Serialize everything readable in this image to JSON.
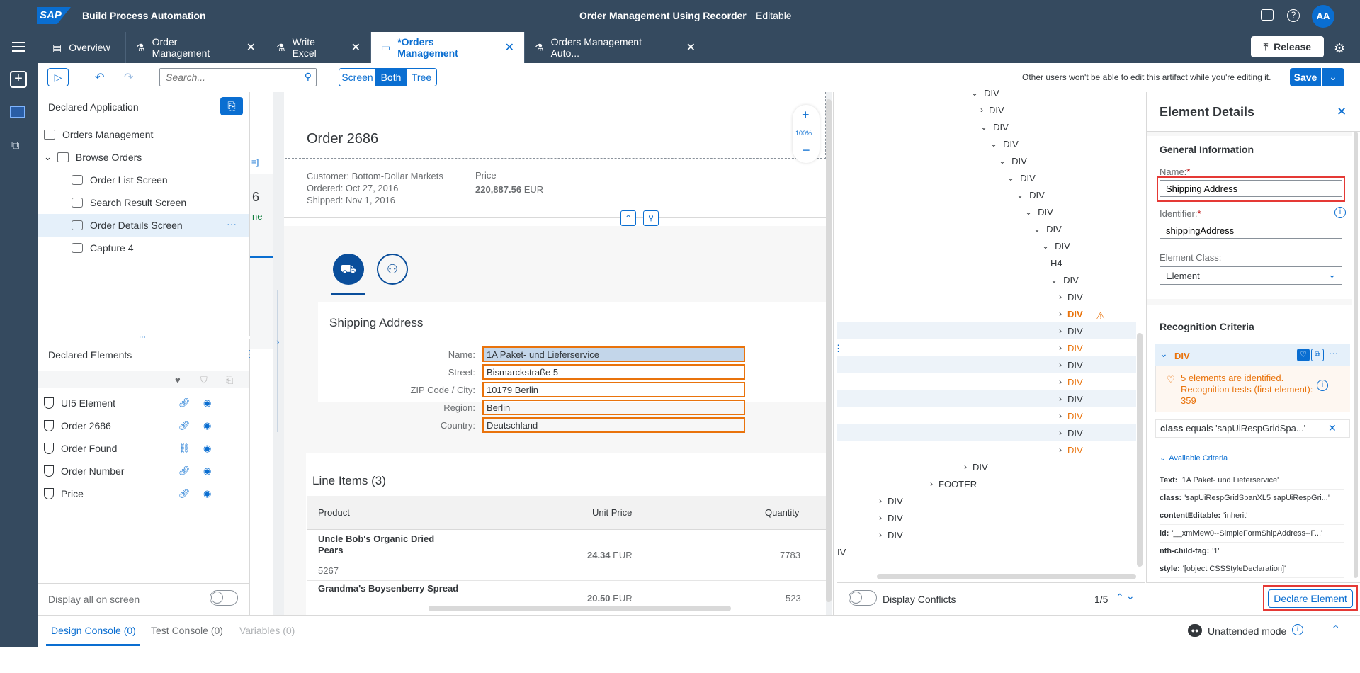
{
  "shell": {
    "logo": "SAP",
    "product": "Build Process Automation",
    "center_title": "Order Management Using Recorder",
    "status": "Editable",
    "avatar": "AA"
  },
  "tabs": [
    {
      "label": "Overview"
    },
    {
      "label": "Order Management"
    },
    {
      "label": "Write Excel"
    },
    {
      "label": "*Orders Management"
    },
    {
      "label": "Orders Management Auto..."
    }
  ],
  "release_label": "Release",
  "toolbar": {
    "search_placeholder": "Search...",
    "seg_screen": "Screen",
    "seg_both": "Both",
    "seg_tree": "Tree",
    "lock_notice": "Other users won't be able to edit this artifact while you're editing it.",
    "save_label": "Save"
  },
  "declared_app": {
    "title": "Declared Application",
    "items": [
      {
        "label": "Orders Management"
      },
      {
        "label": "Browse Orders"
      },
      {
        "label": "Order List Screen"
      },
      {
        "label": "Search Result Screen"
      },
      {
        "label": "Order Details Screen"
      },
      {
        "label": "Capture 4"
      }
    ]
  },
  "declared_elements": {
    "title": "Declared Elements",
    "items": [
      {
        "label": "UI5 Element"
      },
      {
        "label": "Order 2686"
      },
      {
        "label": "Order Found"
      },
      {
        "label": "Order Number"
      },
      {
        "label": "Price"
      }
    ],
    "display_all": "Display all on screen"
  },
  "screen": {
    "order_title": "Order 2686",
    "customer": "Customer: Bottom-Dollar Markets",
    "ordered": "Ordered: Oct 27, 2016",
    "shipped": "Shipped: Nov 1, 2016",
    "price_label": "Price",
    "price_value": "220,887.56",
    "price_currency": "EUR",
    "zoom": "100%",
    "left_partial_num": "6",
    "left_partial_text": "ne",
    "shipping_title": "Shipping Address",
    "fields": [
      {
        "label": "Name:",
        "value": "1A Paket- und Lieferservice"
      },
      {
        "label": "Street:",
        "value": "Bismarckstraße 5"
      },
      {
        "label": "ZIP Code / City:",
        "value": "10179 Berlin"
      },
      {
        "label": "Region:",
        "value": "Berlin"
      },
      {
        "label": "Country:",
        "value": "Deutschland"
      }
    ],
    "line_items_title": "Line Items (3)",
    "col_product": "Product",
    "col_unit_price": "Unit Price",
    "col_quantity": "Quantity",
    "rows": [
      {
        "product": "Uncle Bob's Organic Dried Pears",
        "id": "5267",
        "price": "24.34",
        "currency": "EUR",
        "qty": "7783"
      },
      {
        "product": "Grandma's Boysenberry Spread",
        "id": "",
        "price": "20.50",
        "currency": "EUR",
        "qty": "523"
      }
    ]
  },
  "tree": {
    "rows": [
      {
        "label": "DIV"
      },
      {
        "label": "DIV"
      },
      {
        "label": "DIV"
      },
      {
        "label": "DIV"
      },
      {
        "label": "DIV"
      },
      {
        "label": "DIV"
      },
      {
        "label": "DIV"
      },
      {
        "label": "DIV"
      },
      {
        "label": "DIV"
      },
      {
        "label": "DIV"
      },
      {
        "label": "H4"
      },
      {
        "label": "DIV"
      },
      {
        "label": "DIV"
      },
      {
        "label": "DIV"
      },
      {
        "label": "DIV"
      },
      {
        "label": "DIV"
      },
      {
        "label": "DIV"
      },
      {
        "label": "DIV"
      },
      {
        "label": "DIV"
      },
      {
        "label": "DIV"
      },
      {
        "label": "DIV"
      },
      {
        "label": "DIV"
      },
      {
        "label": "DIV"
      },
      {
        "label": "FOOTER"
      },
      {
        "label": "DIV"
      },
      {
        "label": "DIV"
      },
      {
        "label": "DIV"
      },
      {
        "label": "IV"
      }
    ],
    "display_conflicts": "Display Conflicts",
    "pager": "1/5"
  },
  "details": {
    "title": "Element Details",
    "general_info": "General Information",
    "name_label": "Name:",
    "name_value": "Shipping Address",
    "identifier_label": "Identifier:",
    "identifier_value": "shippingAddress",
    "class_label": "Element Class:",
    "class_value": "Element",
    "recognition": "Recognition Criteria",
    "crit_tag": "DIV",
    "warning": "5 elements are identified. Recognition tests (first element): 359",
    "criterion_key": "class",
    "criterion_text": "equals 'sapUiRespGridSpa...'",
    "available": "Available Criteria",
    "criteria": [
      {
        "key": "Text:",
        "val": "'1A Paket- und Lieferservice'"
      },
      {
        "key": "class:",
        "val": "'sapUiRespGridSpanXL5 sapUiRespGri...'"
      },
      {
        "key": "contentEditable:",
        "val": "'inherit'"
      },
      {
        "key": "id:",
        "val": "'__xmlview0--SimpleFormShipAddress--F...'"
      },
      {
        "key": "nth-child-tag:",
        "val": "'1'"
      },
      {
        "key": "style:",
        "val": "'[object CSSStyleDeclaration]'"
      }
    ],
    "declare_label": "Declare Element"
  },
  "bottom": {
    "design_console": "Design Console (0)",
    "test_console": "Test Console (0)",
    "variables": "Variables (0)",
    "unattended": "Unattended mode"
  },
  "colors": {
    "shell": "#354a5f",
    "accent": "#0a6ed1",
    "highlight": "#e9730c",
    "selection_red": "#e53935"
  }
}
